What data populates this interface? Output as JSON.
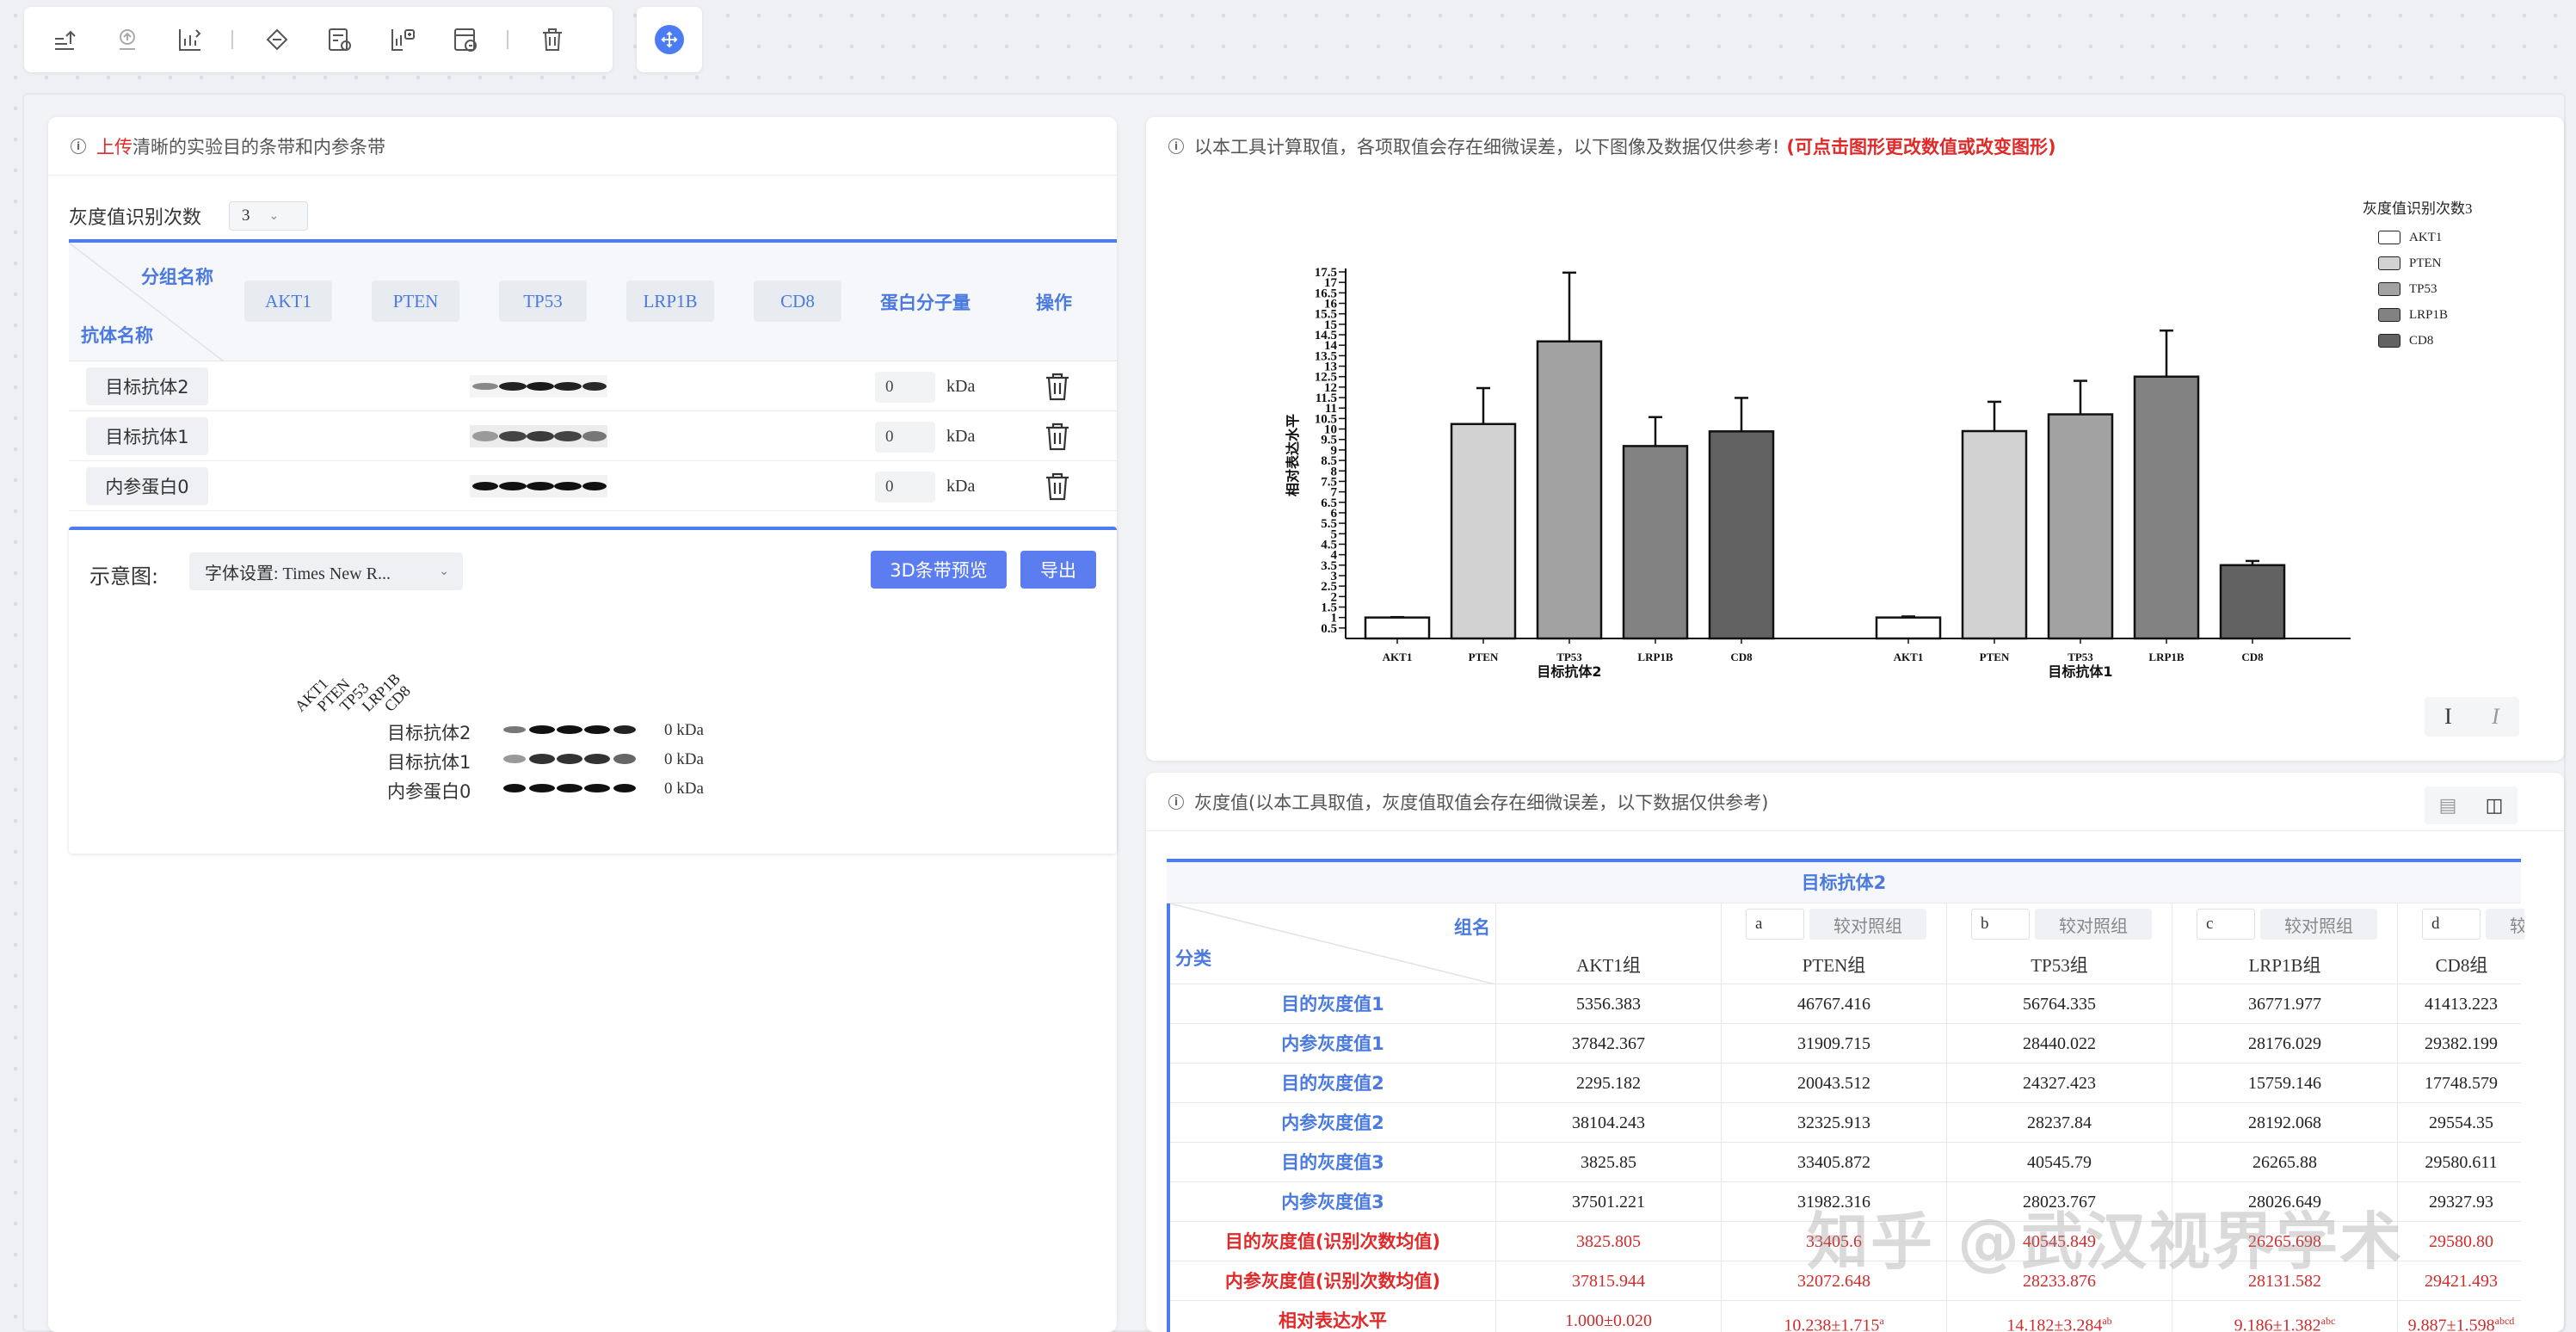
{
  "toolbar": {
    "buttons": [
      "upload-icon",
      "export-icon",
      "chart-icon",
      "diamond-icon",
      "settings-doc-icon",
      "chart-settings-icon",
      "edit-chart-icon",
      "trash-icon"
    ],
    "move_icon": "move-icon"
  },
  "left_panel": {
    "header_prefix": "上传",
    "header_text": "清晰的实验目的条带和内参条带",
    "count_label": "灰度值识别次数",
    "count_value": "3",
    "table": {
      "group_header": "分组名称",
      "antibody_header": "抗体名称",
      "lanes": [
        "AKT1",
        "PTEN",
        "TP53",
        "LRP1B",
        "CD8"
      ],
      "mw_header": "蛋白分子量",
      "op_header": "操作",
      "rows": [
        {
          "name": "目标抗体2",
          "mw": "0",
          "unit": "kDa"
        },
        {
          "name": "目标抗体1",
          "mw": "0",
          "unit": "kDa"
        },
        {
          "name": "内参蛋白0",
          "mw": "0",
          "unit": "kDa"
        }
      ]
    },
    "schematic": {
      "title": "示意图:",
      "font_select": "字体设置: Times New R...",
      "preview_button": "3D条带预览",
      "export_button": "导出",
      "lane_labels": [
        "AKT1",
        "PTEN",
        "TP53",
        "LRP1B",
        "CD8"
      ],
      "rows": [
        {
          "label": "目标抗体2",
          "mw": "0 kDa"
        },
        {
          "label": "目标抗体1",
          "mw": "0 kDa"
        },
        {
          "label": "内参蛋白0",
          "mw": "0 kDa"
        }
      ]
    }
  },
  "chart_panel": {
    "header_text": "以本工具计算取值，各项取值会存在细微误差，以下图像及数据仅供参考!",
    "header_red": "(可点击图形更改数值或改变图形)",
    "text_buttons": [
      "I",
      "I"
    ]
  },
  "chart_data": {
    "type": "bar",
    "ylabel": "相对表达水平",
    "ylim": [
      0,
      17.5
    ],
    "yticks": [
      "0.5",
      "1",
      "1.5",
      "2",
      "2.5",
      "3",
      "3.5",
      "4",
      "4.5",
      "5",
      "5.5",
      "6",
      "6.5",
      "7",
      "7.5",
      "8",
      "8.5",
      "9",
      "9.5",
      "10",
      "10.5",
      "11",
      "11.5",
      "12",
      "12.5",
      "13",
      "13.5",
      "14",
      "14.5",
      "15",
      "15.5",
      "16",
      "16.5",
      "17",
      "17.5"
    ],
    "legend_title": "灰度值识别次数3",
    "categories": [
      "AKT1",
      "PTEN",
      "TP53",
      "LRP1B",
      "CD8"
    ],
    "colors": [
      "#ffffff",
      "#d2d2d2",
      "#a2a2a2",
      "#828282",
      "#626262"
    ],
    "groups": [
      {
        "name": "目标抗体2",
        "values": [
          1.0,
          10.238,
          14.182,
          9.186,
          9.887
        ],
        "errors": [
          0.02,
          1.715,
          3.284,
          1.382,
          1.598
        ]
      },
      {
        "name": "目标抗体1",
        "values": [
          1.0,
          9.9,
          10.7,
          12.5,
          3.5
        ],
        "errors": [
          0.05,
          1.4,
          1.6,
          2.2,
          0.2
        ]
      }
    ]
  },
  "table_panel": {
    "header_text": "灰度值(以本工具取值，灰度值取值会存在细微误差，以下数据仅供参考)",
    "table_title": "目标抗体2",
    "group_name_label": "组名",
    "category_label": "分类",
    "compare_label": "较对照组",
    "columns": [
      {
        "letter": "",
        "name": "AKT1组"
      },
      {
        "letter": "a",
        "name": "PTEN组"
      },
      {
        "letter": "b",
        "name": "TP53组"
      },
      {
        "letter": "c",
        "name": "LRP1B组"
      },
      {
        "letter": "d",
        "name": "CD8组"
      }
    ],
    "rows": [
      {
        "label": "目的灰度值1",
        "values": [
          "5356.383",
          "46767.416",
          "56764.335",
          "36771.977",
          "41413.223"
        ]
      },
      {
        "label": "内参灰度值1",
        "values": [
          "37842.367",
          "31909.715",
          "28440.022",
          "28176.029",
          "29382.199"
        ]
      },
      {
        "label": "目的灰度值2",
        "values": [
          "2295.182",
          "20043.512",
          "24327.423",
          "15759.146",
          "17748.579"
        ]
      },
      {
        "label": "内参灰度值2",
        "values": [
          "38104.243",
          "32325.913",
          "28237.84",
          "28192.068",
          "29554.35"
        ]
      },
      {
        "label": "目的灰度值3",
        "values": [
          "3825.85",
          "33405.872",
          "40545.79",
          "26265.88",
          "29580.611"
        ]
      },
      {
        "label": "内参灰度值3",
        "values": [
          "37501.221",
          "31982.316",
          "28023.767",
          "28026.649",
          "29327.93"
        ]
      },
      {
        "label": "目的灰度值(识别次数均值)",
        "values": [
          "3825.805",
          "33405.6",
          "40545.849",
          "26265.698",
          "29580.80"
        ]
      },
      {
        "label": "内参灰度值(识别次数均值)",
        "values": [
          "37815.944",
          "32072.648",
          "28233.876",
          "28131.582",
          "29421.493"
        ]
      },
      {
        "label": "相对表达水平",
        "values": [
          "1.000±0.020",
          "10.238±1.715",
          "14.182±3.284",
          "9.186±1.382",
          "9.887±1.598"
        ],
        "sups": [
          "",
          "a",
          "ab",
          "abc",
          "abcd"
        ]
      }
    ]
  },
  "watermark": "知乎 @武汉视界学术"
}
